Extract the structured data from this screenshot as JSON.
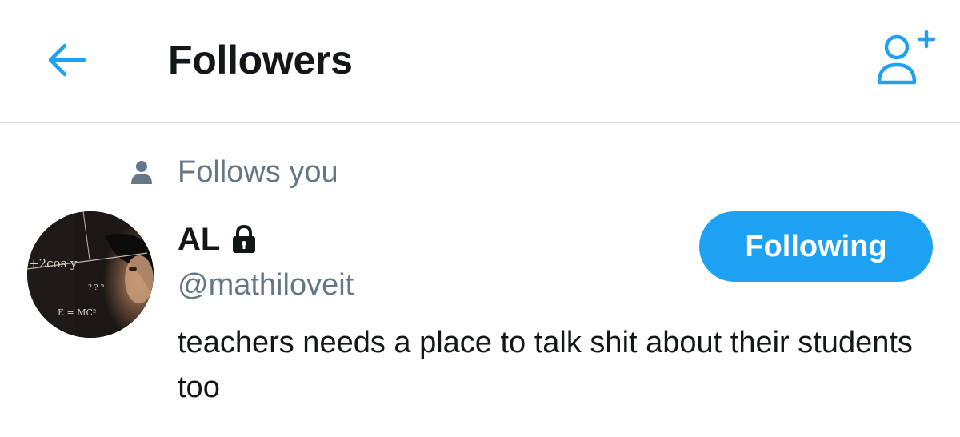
{
  "header": {
    "back_icon": "arrow-left-icon",
    "title": "Followers",
    "add_icon": "add-user-icon"
  },
  "colors": {
    "accent": "#1da1f2",
    "text_primary": "#14171a",
    "text_secondary": "#657786",
    "divider": "#cfd9de"
  },
  "follower": {
    "follows_you_icon": "person-icon",
    "follows_you_label": "Follows you",
    "name": "AL",
    "protected_icon": "lock-icon",
    "handle": "@mathiloveit",
    "bio": "teachers needs a place to talk shit about their students too",
    "button_label": "Following",
    "avatar_text": {
      "formula1": "+2cos y",
      "formula2": "E = MC²",
      "formula3": "? ? ?"
    }
  }
}
